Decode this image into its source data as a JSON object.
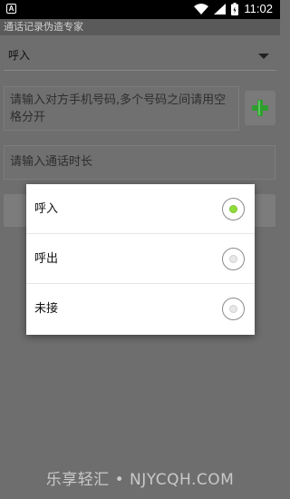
{
  "status_bar": {
    "left_icon_letter": "A",
    "time": "11:02"
  },
  "app": {
    "title": "通话记录伪造专家"
  },
  "spinner": {
    "selected": "呼入"
  },
  "inputs": {
    "phone_placeholder": "请输入对方手机号码,多个号码之间请用空格分开",
    "duration_placeholder": "请输入通话时长"
  },
  "dialog": {
    "options": [
      {
        "label": "呼入",
        "checked": true
      },
      {
        "label": "呼出",
        "checked": false
      },
      {
        "label": "未接",
        "checked": false
      }
    ]
  },
  "watermark": "乐享轻汇 • NJYCQH.COM",
  "colors": {
    "accent_green": "#8fdc3a",
    "plus_green": "#2e9e2e"
  },
  "icons": [
    "wifi-icon",
    "signal-icon",
    "battery-icon",
    "add-icon",
    "dropdown-arrow-icon"
  ]
}
